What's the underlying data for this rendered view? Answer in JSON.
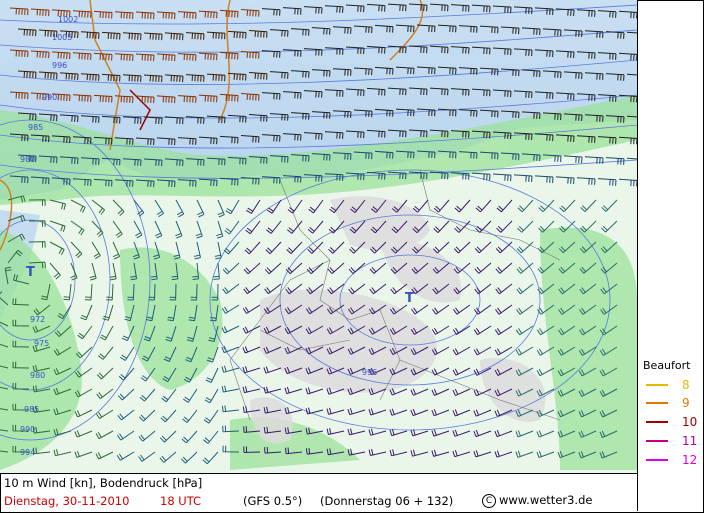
{
  "map": {
    "low_markers": [
      "T",
      "T"
    ],
    "isobar_labels": [
      "1002",
      "1005",
      "996",
      "990",
      "985",
      "980",
      "972",
      "975",
      "980",
      "985",
      "990",
      "994",
      "996"
    ]
  },
  "legend": {
    "title": "Beaufort",
    "items": [
      {
        "value": "8",
        "color": "#e8b800"
      },
      {
        "value": "9",
        "color": "#e07800"
      },
      {
        "value": "10",
        "color": "#a00000"
      },
      {
        "value": "11",
        "color": "#c00080"
      },
      {
        "value": "12",
        "color": "#e000e0"
      }
    ]
  },
  "footer": {
    "line1": "10 m Wind [kn], Bodendruck [hPa]",
    "date": "Dienstag, 30-11-2010",
    "time": "18 UTC",
    "model": "(GFS 0.5°)",
    "run": "(Donnerstag 06 + 132)",
    "copyright_symbol": "C",
    "site": "www.wetter3.de"
  }
}
